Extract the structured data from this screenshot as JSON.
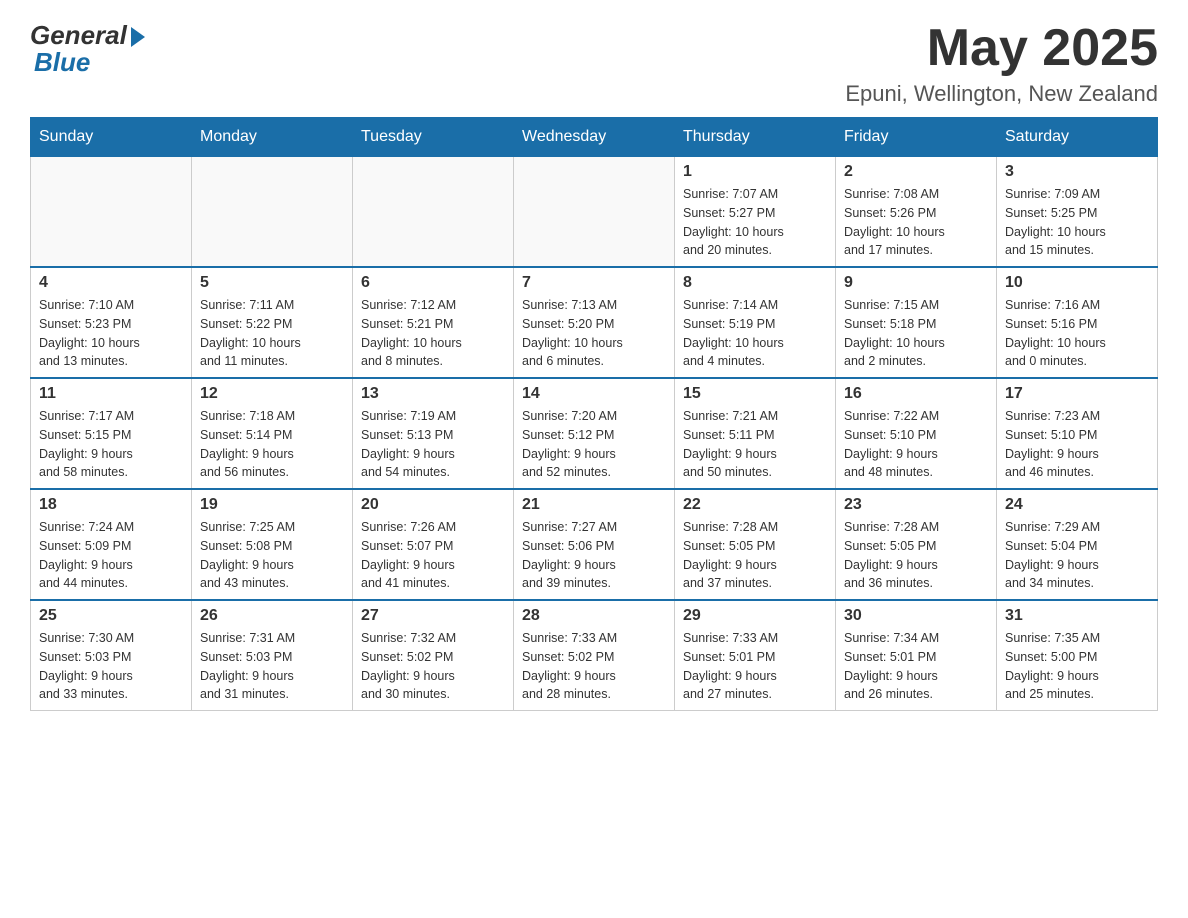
{
  "header": {
    "logo_general": "General",
    "logo_blue": "Blue",
    "month_year": "May 2025",
    "location": "Epuni, Wellington, New Zealand"
  },
  "days_of_week": [
    "Sunday",
    "Monday",
    "Tuesday",
    "Wednesday",
    "Thursday",
    "Friday",
    "Saturday"
  ],
  "weeks": [
    [
      {
        "day": "",
        "info": ""
      },
      {
        "day": "",
        "info": ""
      },
      {
        "day": "",
        "info": ""
      },
      {
        "day": "",
        "info": ""
      },
      {
        "day": "1",
        "info": "Sunrise: 7:07 AM\nSunset: 5:27 PM\nDaylight: 10 hours\nand 20 minutes."
      },
      {
        "day": "2",
        "info": "Sunrise: 7:08 AM\nSunset: 5:26 PM\nDaylight: 10 hours\nand 17 minutes."
      },
      {
        "day": "3",
        "info": "Sunrise: 7:09 AM\nSunset: 5:25 PM\nDaylight: 10 hours\nand 15 minutes."
      }
    ],
    [
      {
        "day": "4",
        "info": "Sunrise: 7:10 AM\nSunset: 5:23 PM\nDaylight: 10 hours\nand 13 minutes."
      },
      {
        "day": "5",
        "info": "Sunrise: 7:11 AM\nSunset: 5:22 PM\nDaylight: 10 hours\nand 11 minutes."
      },
      {
        "day": "6",
        "info": "Sunrise: 7:12 AM\nSunset: 5:21 PM\nDaylight: 10 hours\nand 8 minutes."
      },
      {
        "day": "7",
        "info": "Sunrise: 7:13 AM\nSunset: 5:20 PM\nDaylight: 10 hours\nand 6 minutes."
      },
      {
        "day": "8",
        "info": "Sunrise: 7:14 AM\nSunset: 5:19 PM\nDaylight: 10 hours\nand 4 minutes."
      },
      {
        "day": "9",
        "info": "Sunrise: 7:15 AM\nSunset: 5:18 PM\nDaylight: 10 hours\nand 2 minutes."
      },
      {
        "day": "10",
        "info": "Sunrise: 7:16 AM\nSunset: 5:16 PM\nDaylight: 10 hours\nand 0 minutes."
      }
    ],
    [
      {
        "day": "11",
        "info": "Sunrise: 7:17 AM\nSunset: 5:15 PM\nDaylight: 9 hours\nand 58 minutes."
      },
      {
        "day": "12",
        "info": "Sunrise: 7:18 AM\nSunset: 5:14 PM\nDaylight: 9 hours\nand 56 minutes."
      },
      {
        "day": "13",
        "info": "Sunrise: 7:19 AM\nSunset: 5:13 PM\nDaylight: 9 hours\nand 54 minutes."
      },
      {
        "day": "14",
        "info": "Sunrise: 7:20 AM\nSunset: 5:12 PM\nDaylight: 9 hours\nand 52 minutes."
      },
      {
        "day": "15",
        "info": "Sunrise: 7:21 AM\nSunset: 5:11 PM\nDaylight: 9 hours\nand 50 minutes."
      },
      {
        "day": "16",
        "info": "Sunrise: 7:22 AM\nSunset: 5:10 PM\nDaylight: 9 hours\nand 48 minutes."
      },
      {
        "day": "17",
        "info": "Sunrise: 7:23 AM\nSunset: 5:10 PM\nDaylight: 9 hours\nand 46 minutes."
      }
    ],
    [
      {
        "day": "18",
        "info": "Sunrise: 7:24 AM\nSunset: 5:09 PM\nDaylight: 9 hours\nand 44 minutes."
      },
      {
        "day": "19",
        "info": "Sunrise: 7:25 AM\nSunset: 5:08 PM\nDaylight: 9 hours\nand 43 minutes."
      },
      {
        "day": "20",
        "info": "Sunrise: 7:26 AM\nSunset: 5:07 PM\nDaylight: 9 hours\nand 41 minutes."
      },
      {
        "day": "21",
        "info": "Sunrise: 7:27 AM\nSunset: 5:06 PM\nDaylight: 9 hours\nand 39 minutes."
      },
      {
        "day": "22",
        "info": "Sunrise: 7:28 AM\nSunset: 5:05 PM\nDaylight: 9 hours\nand 37 minutes."
      },
      {
        "day": "23",
        "info": "Sunrise: 7:28 AM\nSunset: 5:05 PM\nDaylight: 9 hours\nand 36 minutes."
      },
      {
        "day": "24",
        "info": "Sunrise: 7:29 AM\nSunset: 5:04 PM\nDaylight: 9 hours\nand 34 minutes."
      }
    ],
    [
      {
        "day": "25",
        "info": "Sunrise: 7:30 AM\nSunset: 5:03 PM\nDaylight: 9 hours\nand 33 minutes."
      },
      {
        "day": "26",
        "info": "Sunrise: 7:31 AM\nSunset: 5:03 PM\nDaylight: 9 hours\nand 31 minutes."
      },
      {
        "day": "27",
        "info": "Sunrise: 7:32 AM\nSunset: 5:02 PM\nDaylight: 9 hours\nand 30 minutes."
      },
      {
        "day": "28",
        "info": "Sunrise: 7:33 AM\nSunset: 5:02 PM\nDaylight: 9 hours\nand 28 minutes."
      },
      {
        "day": "29",
        "info": "Sunrise: 7:33 AM\nSunset: 5:01 PM\nDaylight: 9 hours\nand 27 minutes."
      },
      {
        "day": "30",
        "info": "Sunrise: 7:34 AM\nSunset: 5:01 PM\nDaylight: 9 hours\nand 26 minutes."
      },
      {
        "day": "31",
        "info": "Sunrise: 7:35 AM\nSunset: 5:00 PM\nDaylight: 9 hours\nand 25 minutes."
      }
    ]
  ]
}
